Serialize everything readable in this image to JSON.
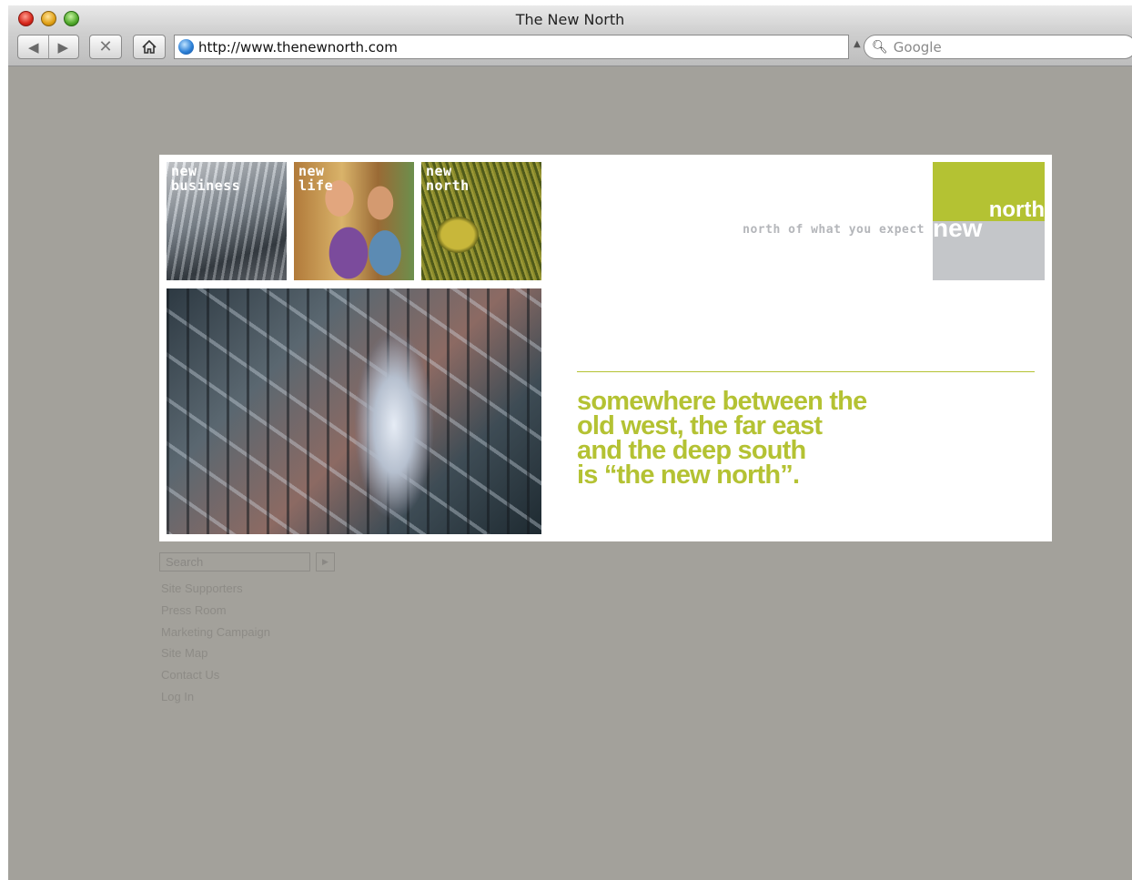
{
  "browser": {
    "title": "The New North",
    "url": "http://www.thenewnorth.com",
    "search_placeholder": "Google"
  },
  "tiles": [
    {
      "line1": "new",
      "line2": "business"
    },
    {
      "line1": "new",
      "line2": "life"
    },
    {
      "line1": "new",
      "line2": "north"
    }
  ],
  "logo": {
    "tagline": "north of what you expect",
    "north": "north",
    "new": "new",
    "green": "#b4c233",
    "gray": "#c4c6c9"
  },
  "headline": [
    "somewhere between the",
    "old west, the far east",
    "and the deep south",
    "is “the new north”."
  ],
  "site_search": {
    "placeholder": "Search"
  },
  "footer_links": [
    "Site Supporters",
    "Press Room",
    "Marketing Campaign",
    "Site Map",
    "Contact Us",
    "Log In"
  ]
}
